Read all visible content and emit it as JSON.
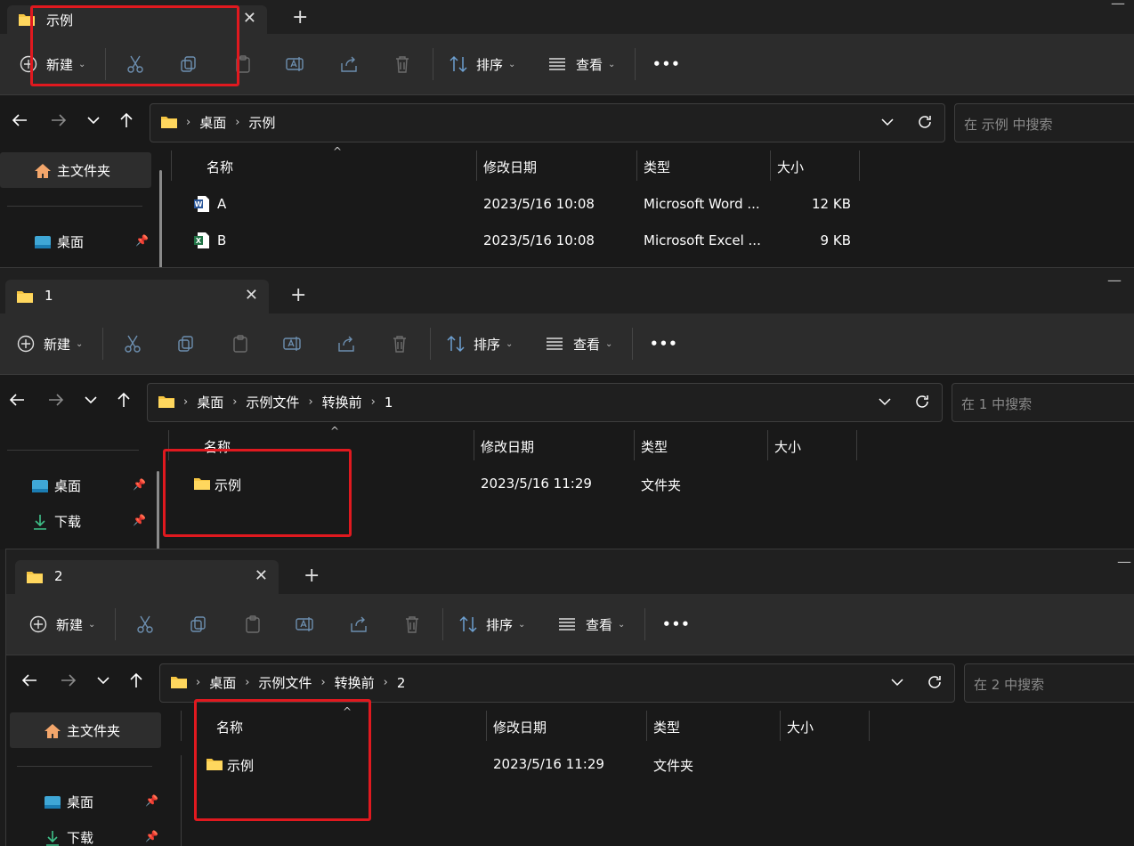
{
  "colors": {
    "folder": "#f5c542",
    "accent_red": "#e0191f",
    "word": "#2b579a",
    "excel": "#217346"
  },
  "windows": [
    {
      "tab_title": "示例",
      "toolbar": {
        "new_label": "新建",
        "sort_label": "排序",
        "view_label": "查看",
        "more_label": "•••"
      },
      "breadcrumb": [
        "桌面",
        "示例"
      ],
      "search_placeholder": "在 示例 中搜索",
      "sidebar": {
        "home": "主文件夹",
        "desktop": "桌面"
      },
      "columns": {
        "name": "名称",
        "modified": "修改日期",
        "type": "类型",
        "size": "大小"
      },
      "files": [
        {
          "name": "A",
          "modified": "2023/5/16 10:08",
          "type": "Microsoft Word ...",
          "size": "12 KB",
          "icon": "word-doc-icon"
        },
        {
          "name": "B",
          "modified": "2023/5/16 10:08",
          "type": "Microsoft Excel ...",
          "size": "9 KB",
          "icon": "excel-doc-icon"
        }
      ]
    },
    {
      "tab_title": "1",
      "toolbar": {
        "new_label": "新建",
        "sort_label": "排序",
        "view_label": "查看",
        "more_label": "•••"
      },
      "breadcrumb": [
        "桌面",
        "示例文件",
        "转换前",
        "1"
      ],
      "search_placeholder": "在 1 中搜索",
      "sidebar": {
        "desktop": "桌面",
        "downloads": "下载"
      },
      "columns": {
        "name": "名称",
        "modified": "修改日期",
        "type": "类型",
        "size": "大小"
      },
      "files": [
        {
          "name": "示例",
          "modified": "2023/5/16 11:29",
          "type": "文件夹",
          "size": "",
          "icon": "folder-icon"
        }
      ]
    },
    {
      "tab_title": "2",
      "toolbar": {
        "new_label": "新建",
        "sort_label": "排序",
        "view_label": "查看",
        "more_label": "•••"
      },
      "breadcrumb": [
        "桌面",
        "示例文件",
        "转换前",
        "2"
      ],
      "search_placeholder": "在 2 中搜索",
      "sidebar": {
        "home": "主文件夹",
        "desktop": "桌面",
        "downloads": "下载"
      },
      "columns": {
        "name": "名称",
        "modified": "修改日期",
        "type": "类型",
        "size": "大小"
      },
      "files": [
        {
          "name": "示例",
          "modified": "2023/5/16 11:29",
          "type": "文件夹",
          "size": "",
          "icon": "folder-icon"
        }
      ]
    }
  ]
}
